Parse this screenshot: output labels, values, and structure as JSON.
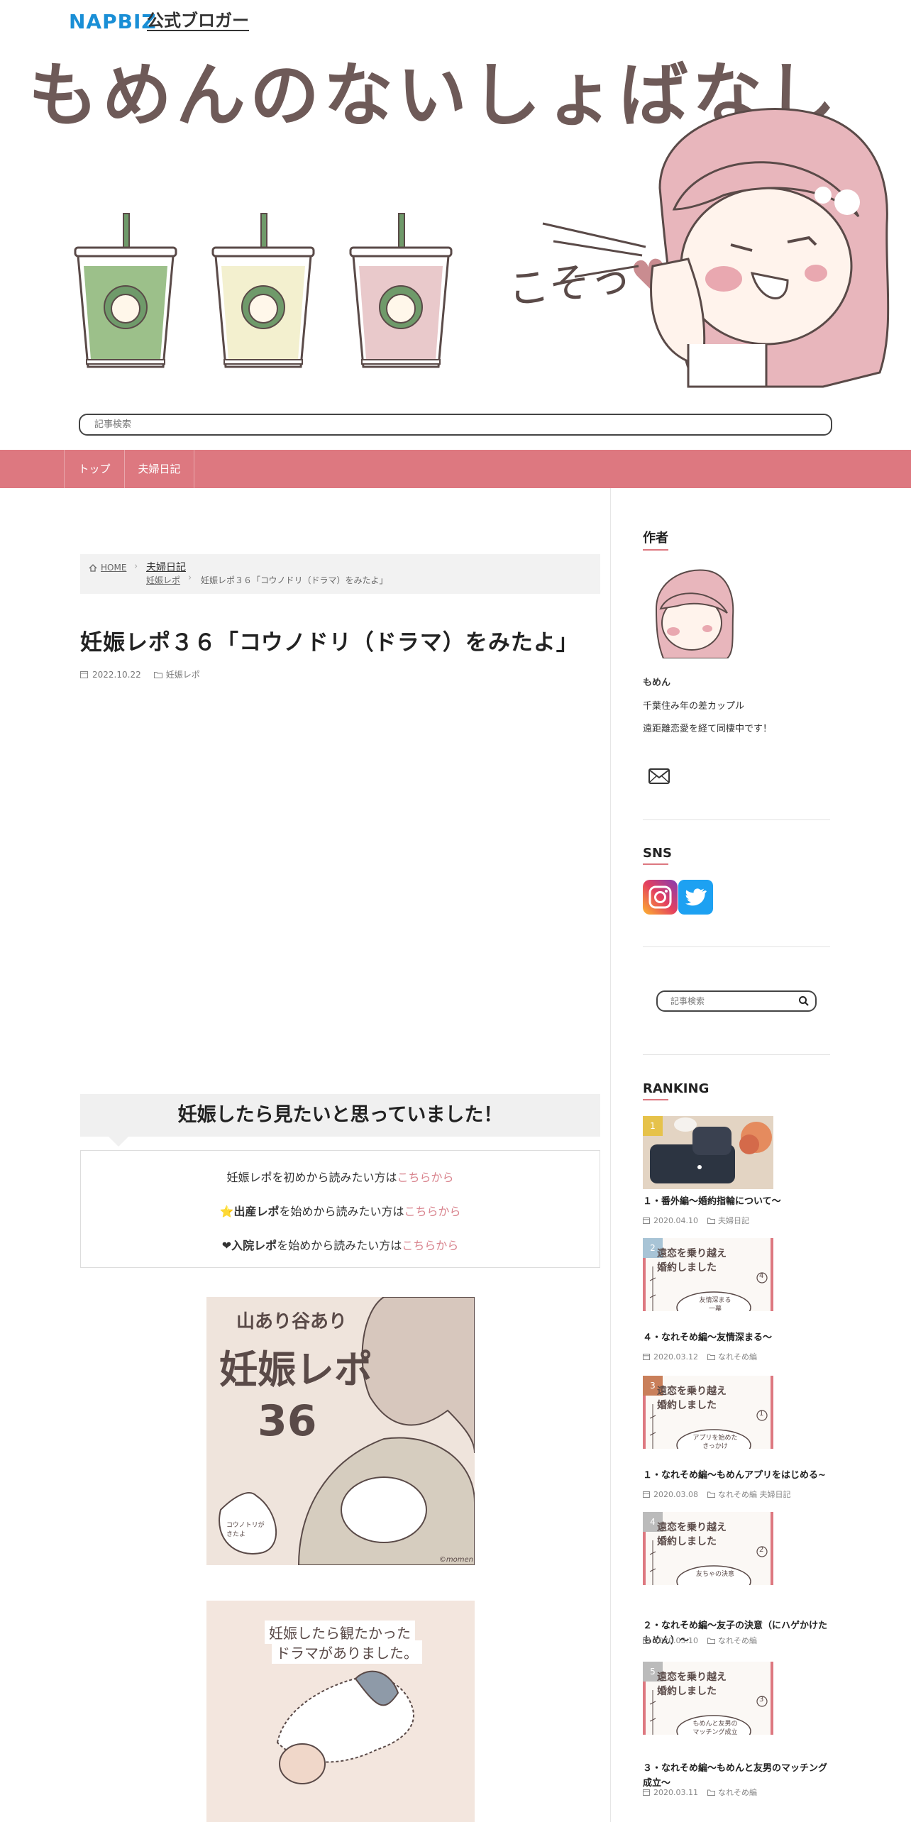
{
  "header": {
    "napbiz_logo": "NAPBIZ",
    "napbiz_sub": "公式ブロガー",
    "site_title": "もめんのないしょばなし",
    "whisper_text": "こそっ",
    "search_placeholder": "記事検索"
  },
  "nav": {
    "items": [
      {
        "label": "トップ"
      },
      {
        "label": "夫婦日記"
      }
    ]
  },
  "breadcrumb": {
    "home": "HOME",
    "category": "夫婦日記",
    "subcategory": "妊娠レポ",
    "current": "妊娠レポ３６「コウノドリ（ドラマ）をみたよ」"
  },
  "post": {
    "title": "妊娠レポ３６「コウノドリ（ドラマ）をみたよ」",
    "date": "2022.10.22",
    "category": "妊娠レポ",
    "box_heading": "妊娠したら見たいと思っていました！",
    "box_lines": [
      {
        "prefix": "",
        "bold": "",
        "text": "妊娠レポを初めから読みたい方は",
        "link": "こちらから"
      },
      {
        "prefix": "⭐",
        "bold": "出産レポ",
        "text": "を始めから読みたい方は",
        "link": "こちらから"
      },
      {
        "prefix": "❤",
        "bold": "入院レポ",
        "text": "を始めから読みたい方は",
        "link": "こちらから"
      }
    ],
    "image1": {
      "top_text": "山あり谷あり",
      "title": "妊娠レポ",
      "number": "36",
      "stork_text": "コウノトリが\nきたよ",
      "credit": "©momen"
    },
    "image2": {
      "line1": "妊娠したら観たかった",
      "line2": "ドラマがありました。"
    }
  },
  "sidebar": {
    "author_heading": "作者",
    "author_name": "もめん",
    "author_line1": "千葉住み年の差カップル",
    "author_line2": "遠距離恋愛を経て同棲中です！",
    "sns_heading": "SNS",
    "search_placeholder": "記事検索",
    "ranking_heading": "RANKING",
    "ranking": [
      {
        "rank": "1",
        "title": "１・番外編～婚約指輪について～",
        "date": "2020.04.10",
        "cats": "夫婦日記",
        "color": "#e6c24a"
      },
      {
        "rank": "2",
        "title": "４・なれそめ編～友情深まる～",
        "date": "2020.03.12",
        "cats": "なれそめ編",
        "color": "#a8c4d6",
        "card_no": "4",
        "card_sub": "友情深まる\n一幕"
      },
      {
        "rank": "3",
        "title": "１・なれそめ編～もめんアプリをはじめる~",
        "date": "2020.03.08",
        "cats": "なれそめ編 夫婦日記",
        "color": "#c97f5a",
        "card_no": "1",
        "card_sub": "アプリを始めた\nきっかけ"
      },
      {
        "rank": "4",
        "title": "２・なれそめ編～友子の決意（にハゲかけたもめん）～",
        "date": "2020.03.10",
        "cats": "なれそめ編",
        "color": "#bbbbbb",
        "card_no": "2",
        "card_sub": "友ちゃの決意"
      },
      {
        "rank": "5",
        "title": "３・なれそめ編～もめんと友男のマッチング成立～",
        "date": "2020.03.11",
        "cats": "なれそめ編",
        "color": "#bbbbbb",
        "card_no": "3",
        "card_sub": "もめんと友男の\nマッチング成立"
      }
    ],
    "card_heading": "遠恋を乗り越え\n婚約しました"
  }
}
